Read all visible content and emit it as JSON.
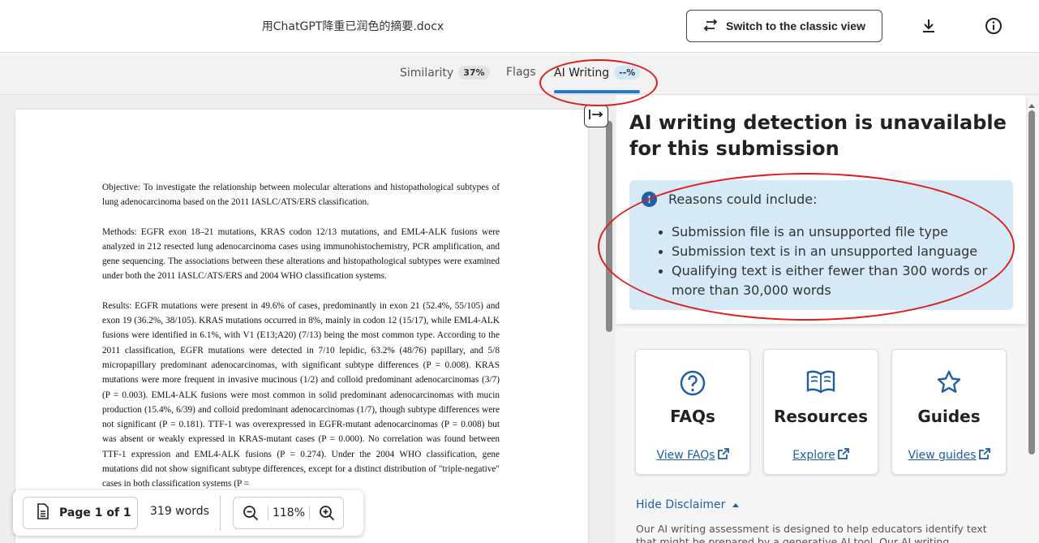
{
  "header": {
    "filename": "用ChatGPT降重已润色的摘要.docx",
    "classic_view_label": "Switch to the classic view",
    "download_icon": "download-icon",
    "info_icon": "info-icon"
  },
  "tabs": [
    {
      "label": "Similarity",
      "badge": "37%"
    },
    {
      "label": "Flags",
      "badge": ""
    },
    {
      "label": "AI Writing",
      "badge": "--%"
    }
  ],
  "document": {
    "paragraphs": [
      "Objective: To investigate the relationship between molecular alterations and histopathological subtypes of lung adenocarcinoma based on the 2011 IASLC/ATS/ERS classification.",
      "Methods: EGFR exon 18–21 mutations, KRAS codon 12/13 mutations, and EML4-ALK fusions were analyzed in 212 resected lung adenocarcinoma cases using immunohistochemistry, PCR amplification, and gene sequencing. The associations between these alterations and histopathological subtypes were examined under both the 2011 IASLC/ATS/ERS and 2004 WHO classification systems.",
      "Results: EGFR mutations were present in 49.6% of cases, predominantly in exon 21 (52.4%, 55/105) and exon 19 (36.2%, 38/105). KRAS mutations occurred in 8%, mainly in codon 12 (15/17), while EML4-ALK fusions were identified in 6.1%, with V1 (E13;A20) (7/13) being the most common type. According to the 2011 classification, EGFR mutations were detected in 7/10 lepidic, 63.2% (48/76) papillary, and 5/8 micropapillary predominant adenocarcinomas, with significant subtype differences (P = 0.008). KRAS mutations were more frequent in invasive mucinous (1/2) and colloid predominant adenocarcinomas (3/7) (P = 0.003). EML4-ALK fusions were most common in solid predominant adenocarcinomas with mucin production (15.4%, 6/39) and colloid predominant adenocarcinomas (1/7), though subtype differences were not significant (P = 0.181). TTF-1 was overexpressed in EGFR-mutant adenocarcinomas (P = 0.008) but was absent or weakly expressed in KRAS-mutant cases (P = 0.000). No correlation was found between TTF-1 expression and EML4-ALK fusions (P = 0.274). Under the 2004 WHO classification, gene mutations did not show significant subtype differences, except for a distinct distribution of \"triple-negative\" cases in both classification systems (P ="
    ]
  },
  "toolbar": {
    "page_label": "Page 1 of 1",
    "words": "319 words",
    "zoom": "118%"
  },
  "panel": {
    "title": "AI writing detection is unavailable for this submission",
    "reasons_intro": "Reasons could include:",
    "reasons": [
      "Submission file is an unsupported file type",
      "Submission text is in an unsupported language",
      "Qualifying text is either fewer than 300 words or more than 30,000 words"
    ],
    "cards": [
      {
        "title": "FAQs",
        "link": "View FAQs",
        "icon": "question-circle-icon"
      },
      {
        "title": "Resources",
        "link": "Explore",
        "icon": "open-book-icon"
      },
      {
        "title": "Guides",
        "link": "View guides",
        "icon": "star-icon"
      }
    ],
    "disclaimer_toggle": "Hide Disclaimer",
    "disclaimer_text": "Our AI writing assessment is designed to help educators identify text that might be prepared by a generative AI tool. Our AI writing assessment may not always"
  },
  "colors": {
    "accent": "#1f7ad1",
    "link": "#1f5fa8",
    "annotation_red": "#e01b1b",
    "reason_box": "#d6e9f7"
  }
}
